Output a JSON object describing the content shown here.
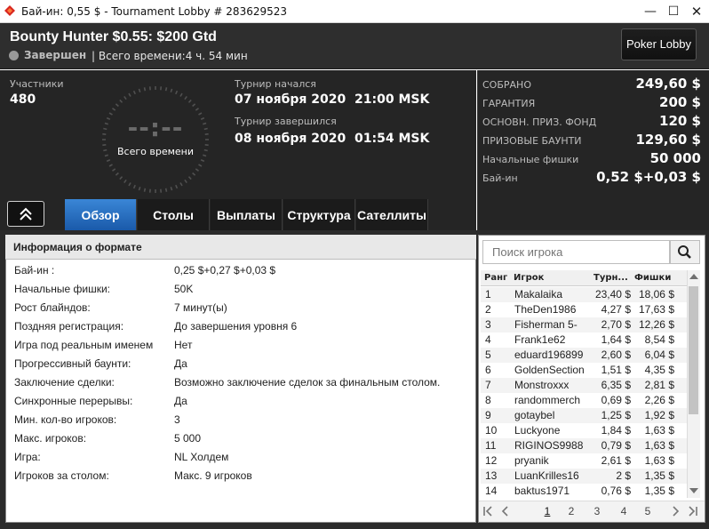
{
  "window": {
    "title": "Бай-ин: 0,55 $ - Tournament Lobby # 283629523",
    "min": "—",
    "max": "☐",
    "close": "✕"
  },
  "header": {
    "title": "Bounty Hunter $0.55: $200 Gtd",
    "status": "Завершен",
    "total_time": "| Всего времени:4 ч. 54 мин",
    "lobby_button": "Poker Lobby"
  },
  "info": {
    "participants_label": "Участники",
    "participants": "480",
    "clock_digits": "--:--",
    "clock_label": "Всего времени",
    "started_label": "Турнир начался",
    "started": "07 ноября 2020  21:00 MSK",
    "finished_label": "Турнир завершился",
    "finished": "08 ноября 2020  01:54 MSK"
  },
  "stats": [
    {
      "label": "СОБРАНО",
      "value": "249,60 $"
    },
    {
      "label": "ГАРАНТИЯ",
      "value": "200 $"
    },
    {
      "label": "ОСНОВН. ПРИЗ. ФОНД",
      "value": "120 $"
    },
    {
      "label": "ПРИЗОВЫЕ БАУНТИ",
      "value": "129,60 $"
    },
    {
      "label": "Начальные фишки",
      "value": "50 000"
    },
    {
      "label": "Бай-ин",
      "value": "0,52 $+0,03 $"
    }
  ],
  "tabs": [
    {
      "label": "Обзор",
      "active": true
    },
    {
      "label": "Столы",
      "active": false
    },
    {
      "label": "Выплаты",
      "active": false
    },
    {
      "label": "Структура",
      "active": false
    },
    {
      "label": "Сателлиты",
      "active": false
    }
  ],
  "format": {
    "title": "Информация о формате",
    "rows": [
      {
        "k": "Бай-ин :",
        "v": "0,25 $+0,27 $+0,03 $"
      },
      {
        "k": "Начальные фишки:",
        "v": "50K"
      },
      {
        "k": "Рост блайндов:",
        "v": "7 минут(ы)"
      },
      {
        "k": "Поздняя регистрация:",
        "v": "До завершения уровня 6"
      },
      {
        "k": "Игра под реальным именем",
        "v": "Нет"
      },
      {
        "k": "Прогрессивный баунти:",
        "v": "Да"
      },
      {
        "k": "Заключение сделки:",
        "v": "Возможно заключение сделок за финальным столом."
      },
      {
        "k": "Синхронные перерывы:",
        "v": "Да"
      },
      {
        "k": "Мин. кол-во игроков:",
        "v": "3"
      },
      {
        "k": "Макс. игроков:",
        "v": "5 000"
      },
      {
        "k": "Игра:",
        "v": "NL Холдем"
      },
      {
        "k": "Игроков за столом:",
        "v": "Макс. 9 игроков"
      }
    ]
  },
  "players": {
    "search_placeholder": "Поиск игрока",
    "columns": [
      "Ранг",
      "Игрок",
      "Турн...",
      "Фишки"
    ],
    "rows": [
      [
        "1",
        "Makalaika",
        "23,40 $",
        "18,06 $"
      ],
      [
        "2",
        "TheDen1986",
        "4,27 $",
        "17,63 $"
      ],
      [
        "3",
        "Fisherman 5-",
        "2,70 $",
        "12,26 $"
      ],
      [
        "4",
        "Frank1e62",
        "1,64 $",
        "8,54 $"
      ],
      [
        "5",
        "eduard196899",
        "2,60 $",
        "6,04 $"
      ],
      [
        "6",
        "GoldenSection",
        "1,51 $",
        "4,35 $"
      ],
      [
        "7",
        "Monstroxxx",
        "6,35 $",
        "2,81 $"
      ],
      [
        "8",
        "randommerch",
        "0,69 $",
        "2,26 $"
      ],
      [
        "9",
        "gotaybel",
        "1,25 $",
        "1,92 $"
      ],
      [
        "10",
        "Luckyone",
        "1,84 $",
        "1,63 $"
      ],
      [
        "11",
        "RIGINOS9988",
        "0,79 $",
        "1,63 $"
      ],
      [
        "12",
        "pryanik",
        "2,61 $",
        "1,63 $"
      ],
      [
        "13",
        "LuanKrilles16",
        "2 $",
        "1,35 $"
      ],
      [
        "14",
        "baktus1971",
        "0,76 $",
        "1,35 $"
      ]
    ],
    "pages": [
      "1",
      "2",
      "3",
      "4",
      "5"
    ],
    "current_page": "1"
  },
  "colors": {
    "accent_tab": "#2a72c4",
    "header_bg": "#2e2e2e",
    "panel_bg": "#252525"
  }
}
